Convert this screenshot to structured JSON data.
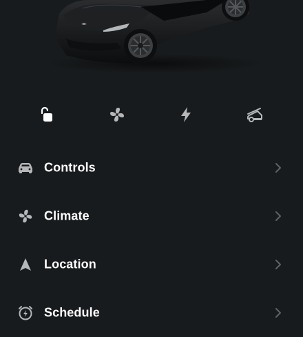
{
  "vehicle": {
    "image": "black-sedan-front-three-quarter-view"
  },
  "quick_controls": [
    {
      "name": "unlock",
      "icon": "unlock-icon"
    },
    {
      "name": "climate",
      "icon": "fan-icon"
    },
    {
      "name": "charging",
      "icon": "bolt-icon"
    },
    {
      "name": "frunk",
      "icon": "frunk-open-icon"
    }
  ],
  "menu": {
    "items": [
      {
        "label": "Controls",
        "icon": "car-icon"
      },
      {
        "label": "Climate",
        "icon": "fan-icon"
      },
      {
        "label": "Location",
        "icon": "navigation-arrow-icon"
      },
      {
        "label": "Schedule",
        "icon": "alarm-clock-bolt-icon"
      }
    ]
  },
  "colors": {
    "background": "#181b1d",
    "icon_active": "#ffffff",
    "icon_inactive": "#b5b7b9",
    "chevron": "#5f6366"
  }
}
